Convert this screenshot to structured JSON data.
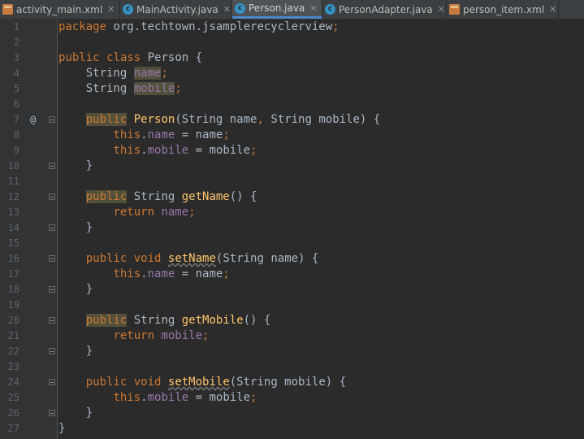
{
  "tabs": [
    {
      "label": "activity_main.xml",
      "icon": "xml-file-icon",
      "active": false
    },
    {
      "label": "MainActivity.java",
      "icon": "java-class-icon",
      "active": false
    },
    {
      "label": "Person.java",
      "icon": "java-class-icon",
      "active": true
    },
    {
      "label": "PersonAdapter.java",
      "icon": "java-class-icon",
      "active": false
    },
    {
      "label": "person_item.xml",
      "icon": "xml-file-icon",
      "active": false
    }
  ],
  "editor": {
    "gutter_marker": "@",
    "lines": [
      {
        "n": "1",
        "text": "package org.techtown.jsamplerecyclerview;"
      },
      {
        "n": "2",
        "text": ""
      },
      {
        "n": "3",
        "text": "public class Person {"
      },
      {
        "n": "4",
        "text": "    String name;"
      },
      {
        "n": "5",
        "text": "    String mobile;"
      },
      {
        "n": "6",
        "text": ""
      },
      {
        "n": "7",
        "text": "    public Person(String name, String mobile) {"
      },
      {
        "n": "8",
        "text": "        this.name = name;"
      },
      {
        "n": "9",
        "text": "        this.mobile = mobile;"
      },
      {
        "n": "10",
        "text": "    }"
      },
      {
        "n": "11",
        "text": ""
      },
      {
        "n": "12",
        "text": "    public String getName() {"
      },
      {
        "n": "13",
        "text": "        return name;"
      },
      {
        "n": "14",
        "text": "    }"
      },
      {
        "n": "15",
        "text": ""
      },
      {
        "n": "16",
        "text": "    public void setName(String name) {"
      },
      {
        "n": "17",
        "text": "        this.name = name;"
      },
      {
        "n": "18",
        "text": "    }"
      },
      {
        "n": "19",
        "text": ""
      },
      {
        "n": "20",
        "text": "    public String getMobile() {"
      },
      {
        "n": "21",
        "text": "        return mobile;"
      },
      {
        "n": "22",
        "text": "    }"
      },
      {
        "n": "23",
        "text": ""
      },
      {
        "n": "24",
        "text": "    public void setMobile(String mobile) {"
      },
      {
        "n": "25",
        "text": "        this.mobile = mobile;"
      },
      {
        "n": "26",
        "text": "    }"
      },
      {
        "n": "27",
        "text": "}"
      }
    ]
  },
  "colors": {
    "background": "#2b2b2b",
    "gutter": "#313335",
    "keyword": "#cc7832",
    "field": "#9876aa",
    "method": "#ffc66d",
    "text": "#a9b7c6",
    "line_number": "#606366",
    "active_tab_underline": "#4a88c7"
  }
}
